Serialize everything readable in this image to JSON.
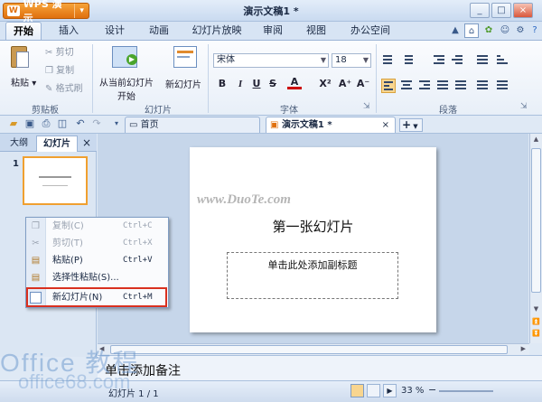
{
  "app": {
    "brand": "WPS 演示",
    "brand_arrow": "▾",
    "doc_title": "演示文稿1 *"
  },
  "window_buttons": [
    "_",
    "□",
    "×"
  ],
  "menu": {
    "tabs": [
      "开始",
      "插入",
      "设计",
      "动画",
      "幻灯片放映",
      "审阅",
      "视图",
      "办公空间"
    ],
    "active": "开始"
  },
  "ribbon": {
    "clipboard": {
      "paste": "粘贴",
      "paste_arrow": "▾",
      "cut": "剪切",
      "copy": "复制",
      "format_painter": "格式刷",
      "group": "剪贴板"
    },
    "slides": {
      "from_current": "从当前幻灯片",
      "from_current2": "开始",
      "new_slide": "新幻灯片",
      "group": "幻灯片"
    },
    "font": {
      "name": "宋体",
      "size": "18",
      "buttons": [
        "B",
        "I",
        "U",
        "S",
        "A",
        "X²",
        "A⁺",
        "A⁻"
      ],
      "group": "字体"
    },
    "paragraph": {
      "group": "段落"
    }
  },
  "qat": {
    "home_tab": "首页",
    "doc_tab": "演示文稿1 *",
    "add_tab": "+"
  },
  "left_panel": {
    "tab_outline": "大纲",
    "tab_slides": "幻灯片",
    "close": "×",
    "slide_number": "1"
  },
  "slide": {
    "title": "第一张幻灯片",
    "subtitle_placeholder": "单击此处添加副标题"
  },
  "context_menu": {
    "items": [
      {
        "label": "复制(C)",
        "shortcut": "Ctrl+C",
        "enabled": false
      },
      {
        "label": "剪切(T)",
        "shortcut": "Ctrl+X",
        "enabled": false
      },
      {
        "label": "粘贴(P)",
        "shortcut": "Ctrl+V",
        "enabled": true
      },
      {
        "label": "选择性粘贴(S)...",
        "shortcut": "",
        "enabled": true
      },
      {
        "label": "新幻灯片(N)",
        "shortcut": "Ctrl+M",
        "enabled": true
      }
    ]
  },
  "notes": {
    "placeholder": "单击添加备注"
  },
  "status": {
    "slide_counter": "幻灯片 1 / 1",
    "zoom": "33 %"
  },
  "watermarks": {
    "duote": "www.DuoTe.com",
    "office": "Office 教程",
    "office2": "office68.com"
  },
  "colors": {
    "accent": "#e0700d",
    "highlight": "#d9301f",
    "ribbon_bg": "#e8eff8"
  }
}
